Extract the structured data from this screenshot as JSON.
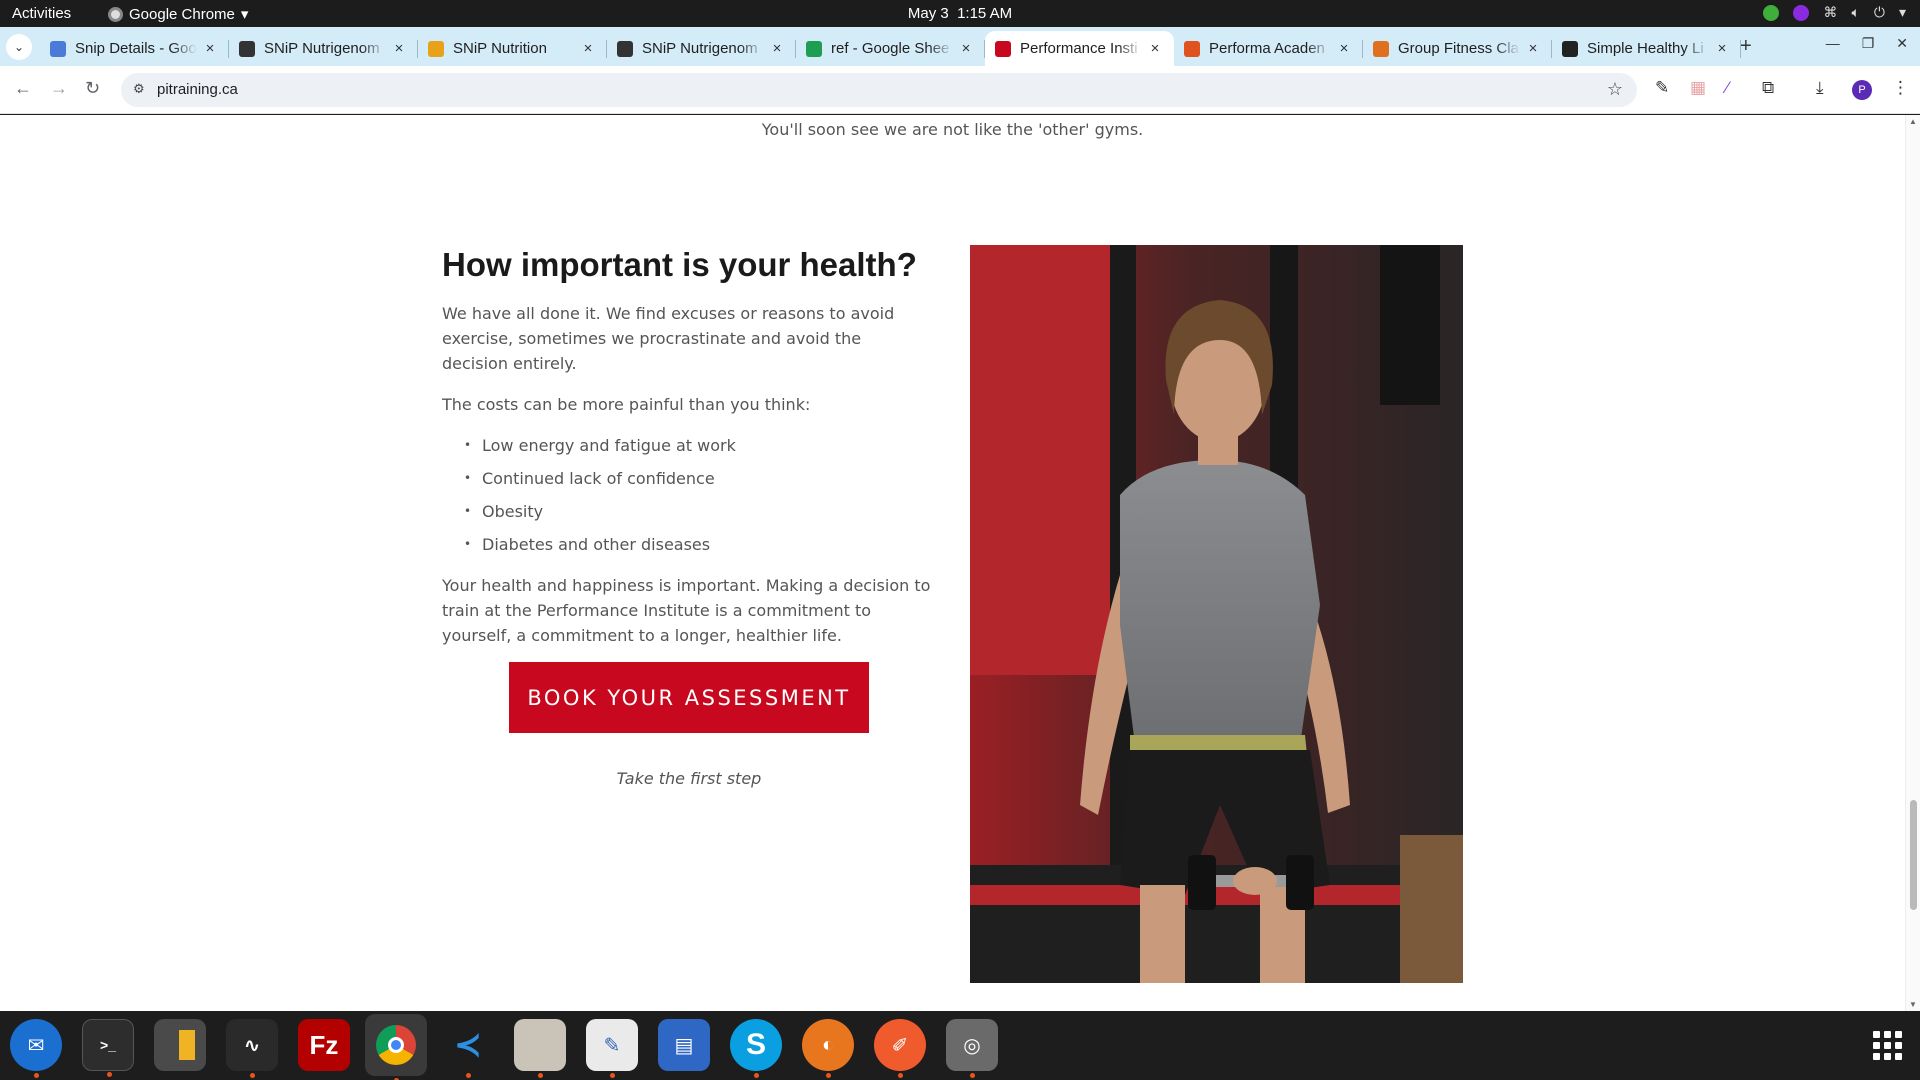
{
  "topbar": {
    "activities": "Activities",
    "app_name": "Google Chrome",
    "date": "May 3",
    "time": "1:15 AM"
  },
  "browser": {
    "tabs": [
      {
        "title": "Snip Details - Goo",
        "favicon_color": "#4a7bd8",
        "favicon": "docs-icon"
      },
      {
        "title": "SNiP Nutrigenom",
        "favicon_color": "#333333",
        "favicon": "snip-icon"
      },
      {
        "title": "SNiP Nutrition",
        "favicon_color": "#e8a21a",
        "favicon": "snip-nutrition-icon"
      },
      {
        "title": "SNiP Nutrigenom",
        "favicon_color": "#333333",
        "favicon": "snip-icon"
      },
      {
        "title": "ref - Google Shee",
        "favicon_color": "#1e9e52",
        "favicon": "sheets-icon"
      },
      {
        "title": "Performance Insti",
        "favicon_color": "#c8081f",
        "favicon": "pi-icon",
        "active": true
      },
      {
        "title": "Performa Acaden",
        "favicon_color": "#e0531f",
        "favicon": "performa-icon"
      },
      {
        "title": "Group Fitness Cla",
        "favicon_color": "#e0701f",
        "favicon": "fitness-icon"
      },
      {
        "title": "Simple Healthy Li",
        "favicon_color": "#222222",
        "favicon": "healthy-icon"
      }
    ],
    "url": "pitraining.ca",
    "profile_initial": "P"
  },
  "page": {
    "tagline": "You'll soon see we are not like the 'other' gyms.",
    "heading": "How important is your health?",
    "intro": "We have all done it. We find excuses or reasons to avoid exercise, sometimes we procrastinate and avoid the decision entirely.",
    "costs_lead": "The costs can be more painful than you think:",
    "costs": [
      "Low energy and fatigue at work",
      "Continued lack of confidence",
      "Obesity",
      "Diabetes and other diseases"
    ],
    "closing": "Your health and happiness is important. Making a decision to train at the Performance Institute is a commitment to yourself, a commitment to a longer, healthier life.",
    "cta_label": "BOOK YOUR ASSESSMENT",
    "cta_note": "Take the first step",
    "brand_red": "#c8081f"
  },
  "dock": {
    "apps": [
      "thunderbird-icon",
      "terminal-icon",
      "calculator-icon",
      "system-monitor-icon",
      "filezilla-icon",
      "chrome-icon",
      "vscode-icon",
      "files-icon",
      "text-editor-icon",
      "document-viewer-icon",
      "skype-icon",
      "blender-icon",
      "postman-icon",
      "disk-icon"
    ]
  }
}
